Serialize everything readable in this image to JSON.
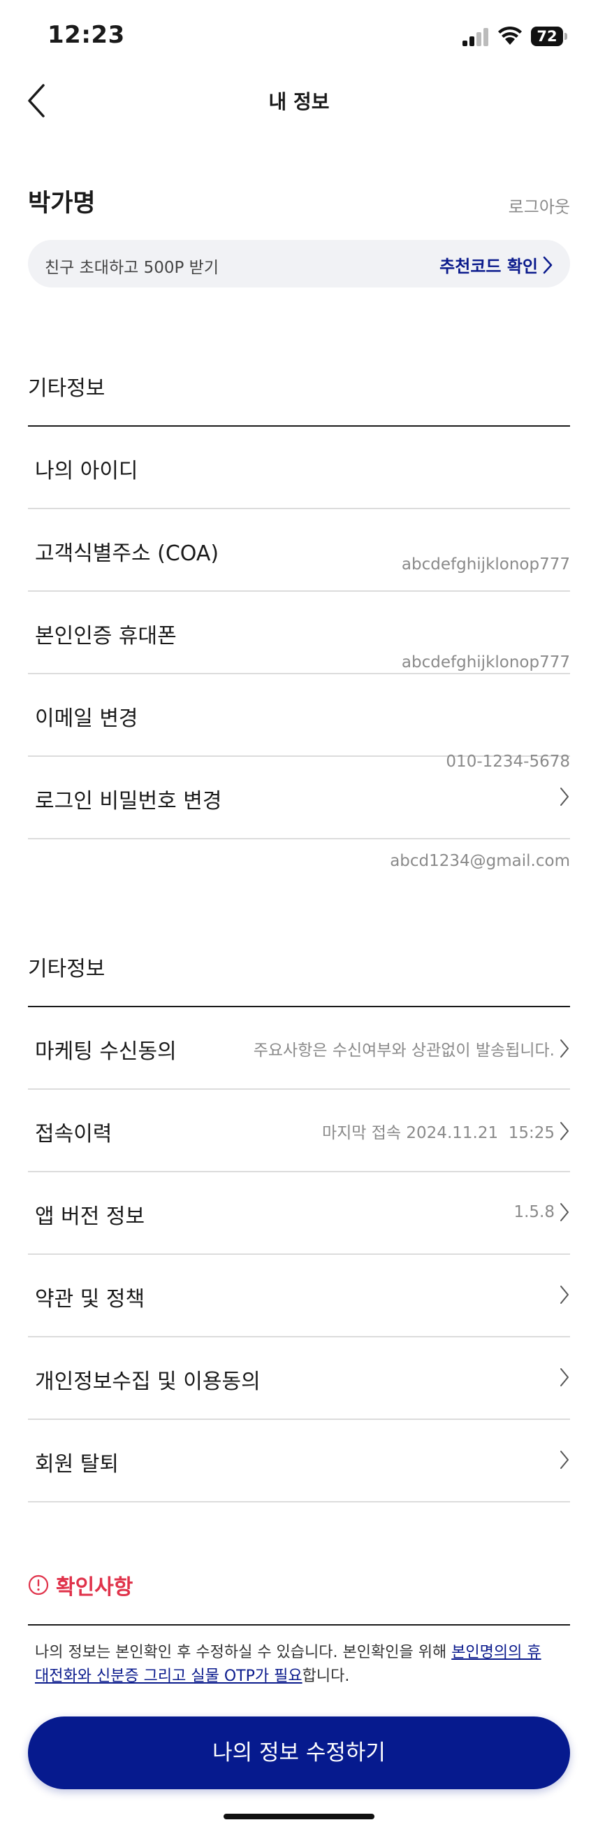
{
  "status_bar": {
    "time": "12:23",
    "battery": "72"
  },
  "header": {
    "title": "내 정보"
  },
  "profile": {
    "name": "박가명",
    "logout_label": "로그아웃"
  },
  "invite": {
    "text": "친구 초대하고 500P 받기",
    "link_label": "추천코드 확인"
  },
  "section1": {
    "title": "기타정보",
    "rows": [
      {
        "label": "나의 아이디"
      },
      {
        "label": "고객식별주소 (COA)",
        "value": "abcdefghijklonop777"
      },
      {
        "label": "본인인증 휴대폰",
        "value": "abcdefghijklonop777"
      },
      {
        "label": "이메일 변경",
        "value": "010-1234-5678"
      },
      {
        "label": "로그인 비밀번호 변경",
        "value": "abcd1234@gmail.com"
      }
    ]
  },
  "section2": {
    "title": "기타정보",
    "rows": [
      {
        "label": "마케팅 수신동의",
        "value": "주요사항은 수신여부와 상관없이 발송됩니다."
      },
      {
        "label": "접속이력",
        "value": "마지막 접속 2024.11.21  15:25"
      },
      {
        "label": "앱 버전 정보",
        "value": "1.5.8"
      },
      {
        "label": "약관 및 정책"
      },
      {
        "label": "개인정보수집 및 이용동의"
      },
      {
        "label": "회원 탈퇴"
      }
    ]
  },
  "notice": {
    "title": "확인사항",
    "text_before": "나의 정보는 본인확인 후 수정하실 수 있습니다. 본인확인을 위해 ",
    "text_link": "본인명의의 휴대전화와 신분증 그리고 실물 OTP가 필요",
    "text_after": "합니다."
  },
  "primary_button": {
    "label": "나의 정보 수정하기"
  },
  "colors": {
    "accent": "#061a8e",
    "link": "#0a1a8c",
    "alert": "#e0324a",
    "muted": "#8a8a8a"
  },
  "icons": [
    "back-icon",
    "chevron-right-icon",
    "alert-icon",
    "signal-icon",
    "wifi-icon",
    "battery-icon"
  ]
}
